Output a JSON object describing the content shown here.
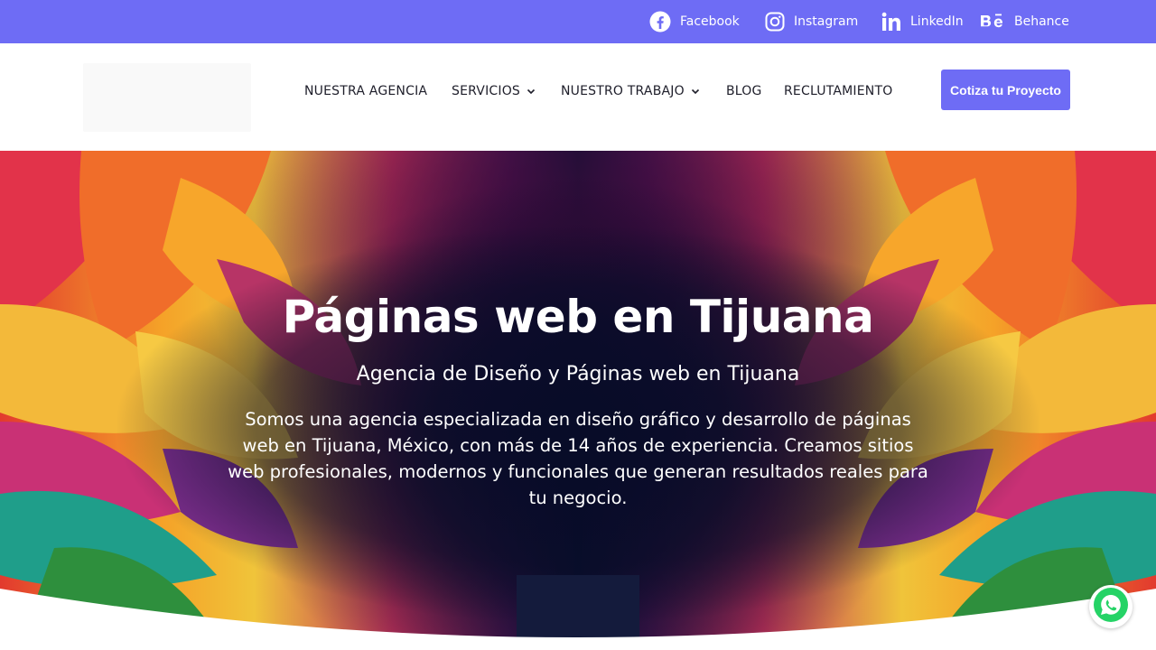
{
  "social": {
    "facebook": "Facebook",
    "instagram": "Instagram",
    "linkedin": "LinkedIn",
    "behance": "Behance"
  },
  "nav": {
    "agencia": "NUESTRA AGENCIA",
    "servicios": "SERVICIOS",
    "trabajo": "NUESTRO TRABAJO",
    "blog": "BLOG",
    "reclutamiento": "RECLUTAMIENTO"
  },
  "cta_label": "Cotiza tu Proyecto",
  "hero": {
    "title": "Páginas web en Tijuana",
    "subtitle": "Agencia de Diseño y Páginas web en Tijuana",
    "description": "Somos una agencia especializada en diseño gráfico y desarrollo de páginas web en Tijuana, México, con más de 14 años de experiencia. Creamos sitios web profesionales, modernos y funcionales que generan resultados reales para tu negocio."
  },
  "colors": {
    "brand": "#6e6cf5",
    "whatsapp": "#25d366"
  },
  "icons": [
    "facebook-icon",
    "instagram-icon",
    "linkedin-icon",
    "behance-icon",
    "chevron-down-icon",
    "whatsapp-icon"
  ]
}
